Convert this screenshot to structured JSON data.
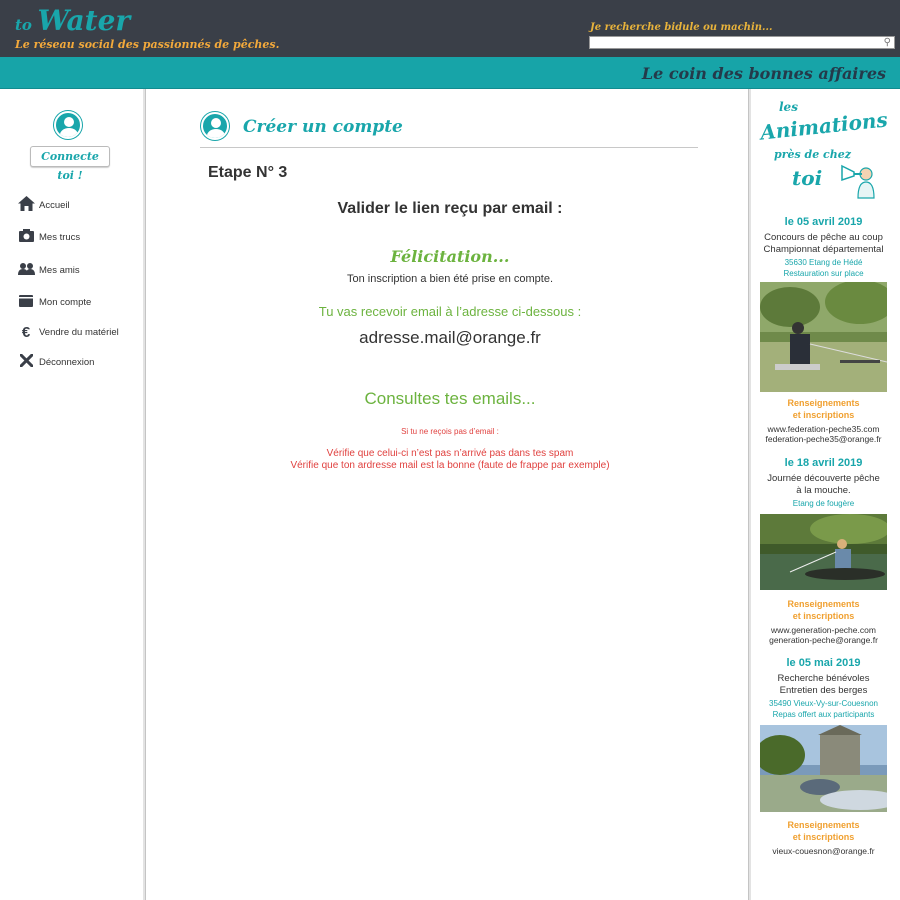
{
  "header": {
    "logo_small": "to",
    "logo_big": "Water",
    "tagline": "Le réseau social des passionnés de pêches.",
    "search_placeholder": "Je recherche bidule ou machin...",
    "banner_title": "Le coin des bonnes affaires"
  },
  "sidebar": {
    "connect_label": "Connecte toi !",
    "items": [
      {
        "label": "Accueil",
        "icon": "home-icon"
      },
      {
        "label": "Mes trucs",
        "icon": "camera-icon"
      },
      {
        "label": "Mes amis",
        "icon": "users-icon"
      },
      {
        "label": "Mon compte",
        "icon": "wallet-icon"
      },
      {
        "label": "Vendre du matériel",
        "icon": "euro-icon"
      },
      {
        "label": "Déconnexion",
        "icon": "close-icon"
      }
    ]
  },
  "main": {
    "title": "Créer un compte",
    "etape": "Etape N° 3",
    "valider": "Valider le lien reçu par email :",
    "felicitation": "Félicitation...",
    "inscription": "Ton inscription a bien été prise en compte.",
    "recevoir": "Tu vas recevoir email à l’adresse ci-dessous :",
    "email": "adresse.mail@orange.fr",
    "consultes": "Consultes tes emails...",
    "si_pas_recu": "Si tu ne reçois pas d’email :",
    "verifie_spam": "Vérifie que celui-ci n’est pas n’arrivé pas dans tes spam",
    "verifie_adresse": "Vérifie que ton ardresse mail est la bonne (faute de frappe par exemple)"
  },
  "animations": {
    "line1": "les",
    "line2": "Animations",
    "line3": "près de chez",
    "line4": "toi",
    "events": [
      {
        "date": "le 05 avril 2019",
        "desc": [
          "Concours de pêche au coup",
          "Championnat départemental"
        ],
        "place": [
          "35630 Etang de Hédé",
          "Restauration sur place"
        ],
        "info": [
          "Renseignements",
          "et inscriptions"
        ],
        "contact": [
          "www.federation-peche35.com",
          "federation-peche35@orange.fr"
        ]
      },
      {
        "date": "le 18 avril 2019",
        "desc": [
          "Journée découverte pêche",
          "à la mouche."
        ],
        "place": [
          "Etang de fougère"
        ],
        "info": [
          "Renseignements",
          "et inscriptions"
        ],
        "contact": [
          "www.generation-peche.com",
          "generation-peche@orange.fr"
        ]
      },
      {
        "date": "le 05 mai 2019",
        "desc": [
          "Recherche bénévoles",
          "Entretien des berges"
        ],
        "place": [
          "35490 Vieux-Vy-sur-Couesnon",
          "Repas offert aux participants"
        ],
        "info": [
          "Renseignements",
          "et inscriptions"
        ],
        "contact": [
          "vieux-couesnon@orange.fr"
        ]
      }
    ]
  }
}
